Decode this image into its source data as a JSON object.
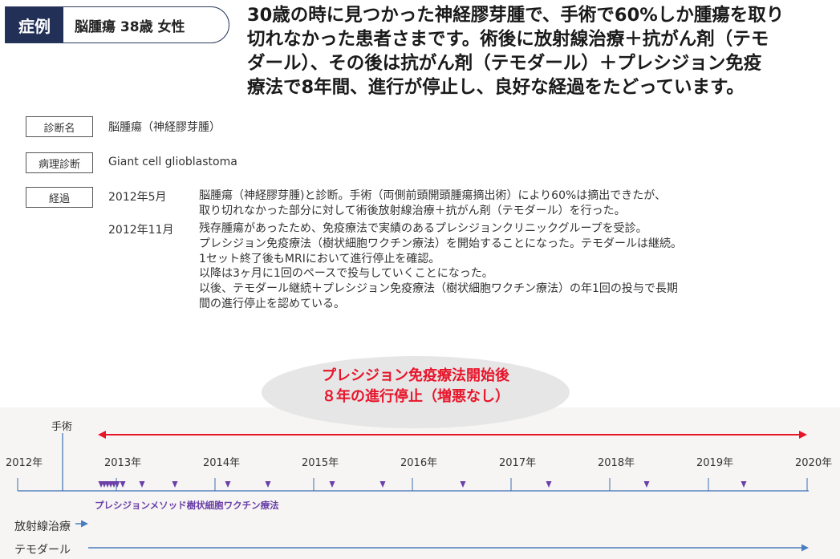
{
  "header": {
    "case_label": "症例",
    "case_subject": "脳腫瘍 38歳 女性",
    "headline_lines": [
      "30歳の時に見つかった神経膠芽腫で、手術で60%しか腫瘍を取り",
      "切れなかった患者さまです。術後に放射線治療＋抗がん剤（テモ",
      "ダール）、その後は抗がん剤（テモダール）＋プレシジョン免疫",
      "療法で8年間、進行が停止し、良好な経過をたどっています。"
    ]
  },
  "info": {
    "diagnosis_label": "診断名",
    "diagnosis_value": "脳腫瘍（神経膠芽腫）",
    "pathology_label": "病理診断",
    "pathology_value": "Giant cell glioblastoma",
    "history_label": "経過",
    "history": [
      {
        "date": "2012年5月",
        "lines": [
          "脳腫瘍（神経膠芽腫)と診断。手術（両側前頭開頭腫瘍摘出術）により60%は摘出できたが、",
          "取り切れなかった部分に対して術後放射線治療＋抗がん剤（テモダール）を行った。"
        ]
      },
      {
        "date": "2012年11月",
        "lines": [
          "残存腫瘍があったため、免疫療法で実績のあるプレシジョンクリニックグループを受診。",
          "プレシジョン免疫療法（樹状細胞ワクチン療法）を開始することになった。テモダールは継続。",
          "1セット終了後もMRIにおいて進行停止を確認。",
          "以降は3ヶ月に1回のペースで投与していくことになった。",
          "以後、テモダール継続＋プレシジョン免疫療法（樹状細胞ワクチン療法）の年1回の投与で長期",
          "間の進行停止を認めている。"
        ]
      }
    ]
  },
  "highlight": {
    "line1": "プレシジョン免疫療法開始後",
    "line2": "８年の進行停止（増悪なし）"
  },
  "timeline": {
    "years": [
      "2012年",
      "2013年",
      "2014年",
      "2015年",
      "2016年",
      "2017年",
      "2018年",
      "2019年",
      "2020年"
    ],
    "surgery_label": "手術",
    "method_label": "プレシジョンメソッド樹状細胞ワクチン療法",
    "radiation_label": "放射線治療",
    "temodal_label": "テモダール",
    "dose_marker_count": 16,
    "colors": {
      "axis": "#3b6fb6",
      "marker": "#6a3fa8",
      "highlight_arrow": "#e8142a",
      "treatment_arrow": "#4a7cc0"
    }
  }
}
